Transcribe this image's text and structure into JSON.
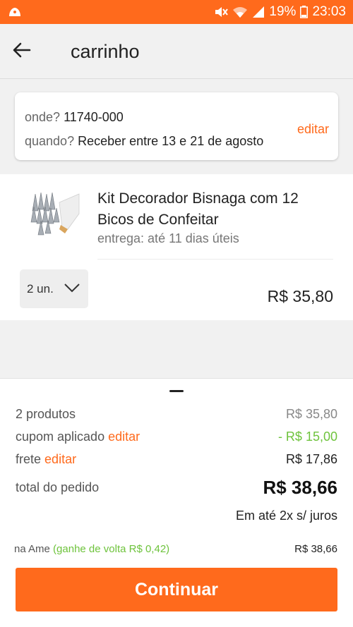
{
  "status_bar": {
    "battery": "19%",
    "time": "23:03",
    "app_icon": "app-notification-icon"
  },
  "app_bar": {
    "title": "carrinho",
    "back_icon": "arrow-left-icon"
  },
  "delivery": {
    "where_label": "onde?",
    "where_value": "11740-000",
    "when_label": "quando?",
    "when_value": "Receber entre 13 e 21 de agosto",
    "edit_label": "editar"
  },
  "product": {
    "name": "Kit Decorador Bisnaga com 12 Bicos de Confeitar",
    "delivery": "entrega: até 11 dias úteis",
    "quantity": "2 un.",
    "price": "R$ 35,80"
  },
  "summary": {
    "products_label": "2 produtos",
    "products_value": "R$ 35,80",
    "coupon_label": "cupom aplicado",
    "coupon_edit": "editar",
    "coupon_value": "- R$ 15,00",
    "shipping_label": "frete",
    "shipping_edit": "editar",
    "shipping_value": "R$ 17,86",
    "total_label": "total do pedido",
    "total_value": "R$ 38,66",
    "installments": "Em até 2x s/ juros",
    "ame_label": "na Ame",
    "ame_cashback": "(ganhe de volta R$ 0,42)",
    "ame_value": "R$ 38,66",
    "continue_label": "Continuar"
  },
  "colors": {
    "brand": "#ff6a1c",
    "green": "#6ec33c"
  }
}
